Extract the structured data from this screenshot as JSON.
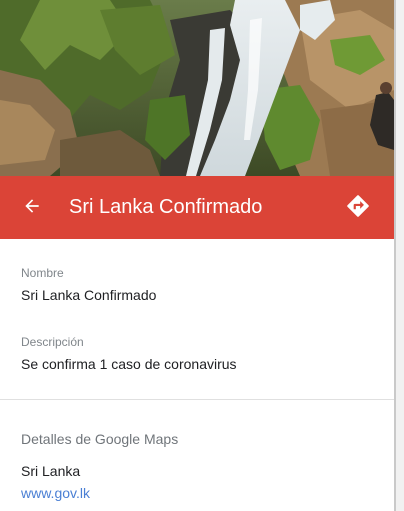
{
  "header": {
    "title": "Sri Lanka Confirmado",
    "back_icon": "arrow-back-icon",
    "directions_icon": "directions-icon",
    "color": "#db4437"
  },
  "hero": {
    "photo": "waterfall"
  },
  "fields": {
    "name_label": "Nombre",
    "name_value": "Sri Lanka Confirmado",
    "description_label": "Descripción",
    "description_value": "Se confirma 1 caso de coronavirus"
  },
  "maps_details": {
    "heading": "Detalles de Google Maps",
    "place": "Sri Lanka",
    "website": "www.gov.lk"
  },
  "colors": {
    "accent": "#db4437",
    "link": "#4a7fd4"
  }
}
